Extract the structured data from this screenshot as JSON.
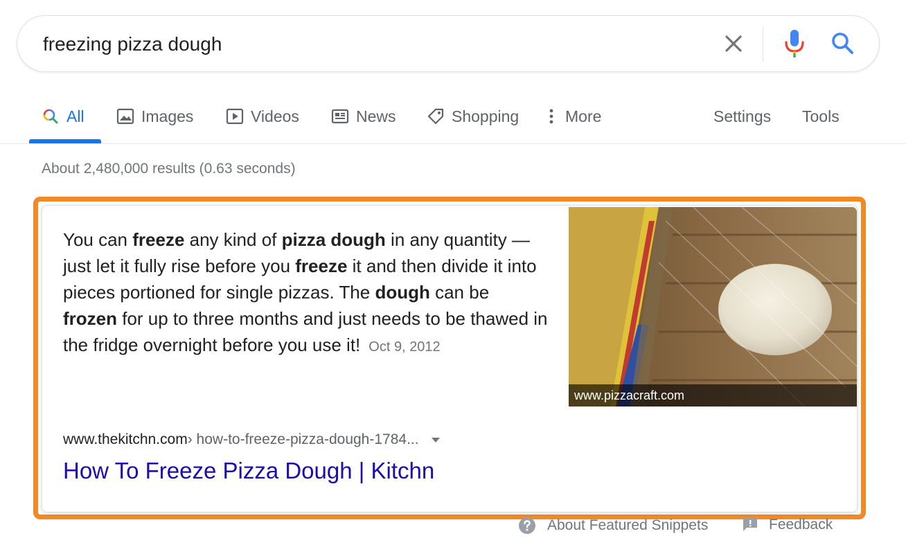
{
  "search": {
    "query": "freezing pizza dough"
  },
  "tabs": [
    {
      "label": "All"
    },
    {
      "label": "Images"
    },
    {
      "label": "Videos"
    },
    {
      "label": "News"
    },
    {
      "label": "Shopping"
    },
    {
      "label": "More"
    }
  ],
  "tools": {
    "settings_label": "Settings",
    "tools_label": "Tools"
  },
  "result_stats": "About 2,480,000 results (0.63 seconds)",
  "featured_snippet": {
    "text_parts": [
      "You can ",
      "freeze",
      " any kind of ",
      "pizza dough",
      " in any quantity — just let it fully rise before you ",
      "freeze",
      " it and then divide it into pieces portioned for single pizzas. The ",
      "dough",
      " can be ",
      "frozen",
      " for up to three months and just needs to be thawed in the fridge overnight before you use it!"
    ],
    "date": "Oct 9, 2012",
    "image_caption": "www.pizzacraft.com",
    "cite_domain": "www.thekitchn.com",
    "cite_path": " › how-to-freeze-pizza-dough-1784...",
    "title": "How To Freeze Pizza Dough | Kitchn"
  },
  "footer": {
    "about_label": "About Featured Snippets",
    "feedback_label": "Feedback"
  },
  "colors": {
    "accent": "#1a73e8",
    "link": "#1a0dab",
    "highlight_border": "#f08a24"
  },
  "icons": [
    "close-icon",
    "mic-icon",
    "search-icon",
    "image-icon",
    "video-icon",
    "news-icon",
    "tag-icon",
    "more-vert-icon",
    "help-icon",
    "feedback-icon"
  ]
}
